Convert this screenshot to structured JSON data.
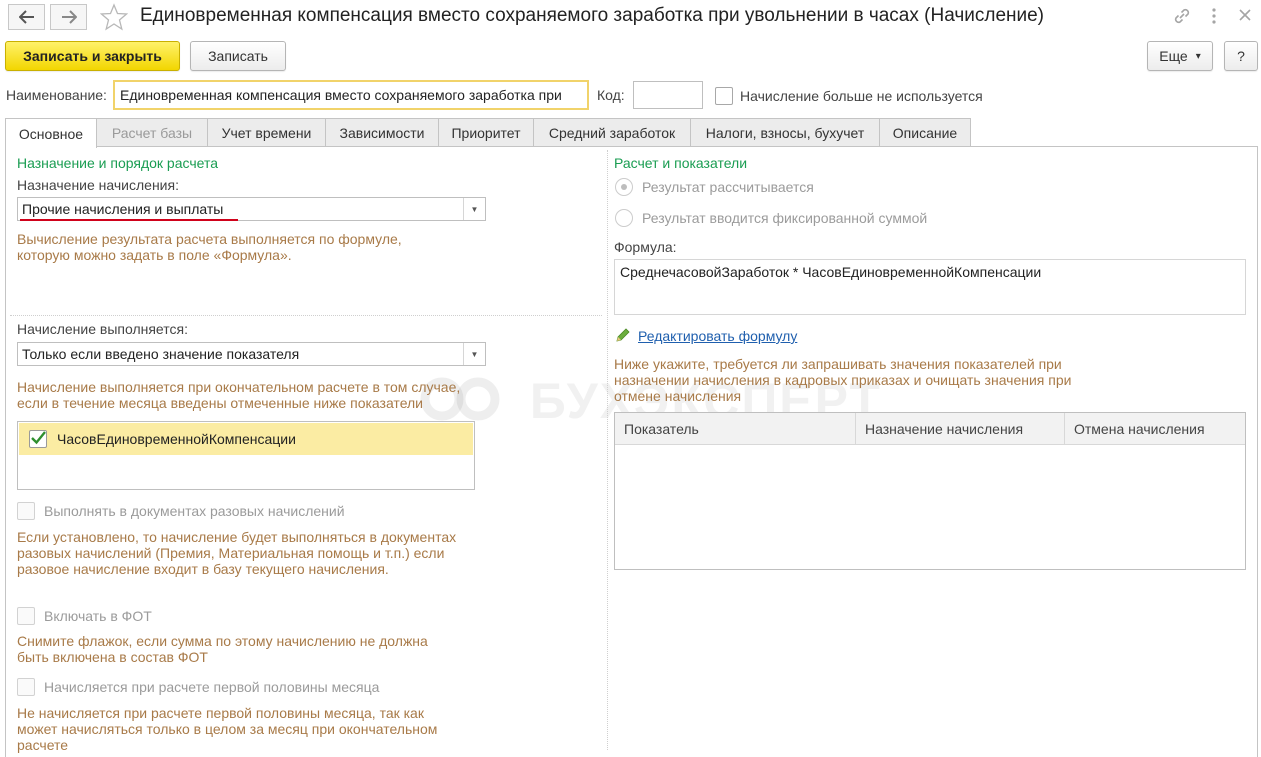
{
  "window": {
    "title": "Единовременная компенсация вместо сохраняемого заработка при увольнении в часах (Начисление)"
  },
  "toolbar": {
    "save_close": "Записать и закрыть",
    "save": "Записать",
    "more": "Еще",
    "more_arrow": "▾",
    "help": "?"
  },
  "header": {
    "name_label": "Наименование:",
    "name_value": "Единовременная компенсация вместо сохраняемого заработка при",
    "code_label": "Код:",
    "code_value": "",
    "not_used_label": "Начисление больше не используется"
  },
  "tabs": [
    {
      "label": "Основное"
    },
    {
      "label": "Расчет базы"
    },
    {
      "label": "Учет времени"
    },
    {
      "label": "Зависимости"
    },
    {
      "label": "Приоритет"
    },
    {
      "label": "Средний заработок"
    },
    {
      "label": "Налоги, взносы, бухучет"
    },
    {
      "label": "Описание"
    }
  ],
  "left": {
    "section_title": "Назначение и порядок расчета",
    "purpose_label": "Назначение начисления:",
    "purpose_value": "Прочие начисления и выплаты",
    "purpose_hint": "Вычисление результата расчета выполняется по формуле, которую можно задать в поле «Формула».",
    "execution_label": "Начисление выполняется:",
    "execution_value": "Только если введено значение показателя",
    "execution_hint": "Начисление выполняется при окончательном расчете в том случае, если в течение месяца введены отмеченные ниже показатели",
    "indicators": [
      {
        "label": "ЧасовЕдиновременнойКомпенсации",
        "checked": true
      }
    ],
    "one_time_label": "Выполнять в документах разовых начислений",
    "one_time_hint": "Если установлено, то начисление будет выполняться в документах разовых начислений (Премия, Материальная помощь и т.п.) если разовое начисление входит в базу текущего начисления.",
    "fot_label": "Включать в ФОТ",
    "fot_hint": "Снимите флажок, если сумма по этому начислению не должна быть включена в состав ФОТ",
    "first_half_label": "Начисляется при расчете первой половины месяца",
    "first_half_hint": "Не начисляется при расчете первой половины месяца, так как может начисляться только в целом за месяц при окончательном расчете"
  },
  "right": {
    "section_title": "Расчет и показатели",
    "radio_calculated": "Результат рассчитывается",
    "radio_fixed": "Результат вводится фиксированной суммой",
    "formula_label": "Формула:",
    "formula_value": "СреднечасовойЗаработок * ЧасовЕдиновременнойКомпенсации",
    "edit_formula_link": "Редактировать формулу",
    "request_hint": "Ниже укажите, требуется ли запрашивать значения показателей при назначении начисления в кадровых приказах и очищать значения при отмене начисления",
    "table_columns": [
      "Показатель",
      "Назначение начисления",
      "Отмена начисления"
    ]
  },
  "watermark": "БУХЭКСПЕРТ",
  "colors": {
    "accent_yellow": "#f2d600",
    "section_green": "#1a9d52",
    "hint_brown": "#a87a48",
    "link_blue": "#1f5fae",
    "underline_red": "#d0021b"
  },
  "icons": {
    "back": "arrow-left-icon",
    "forward": "arrow-right-icon",
    "favorite": "star-icon",
    "link": "link-icon",
    "menu": "more-vertical-icon",
    "close": "close-icon",
    "edit": "pencil-icon",
    "checkmark": "check-icon"
  }
}
